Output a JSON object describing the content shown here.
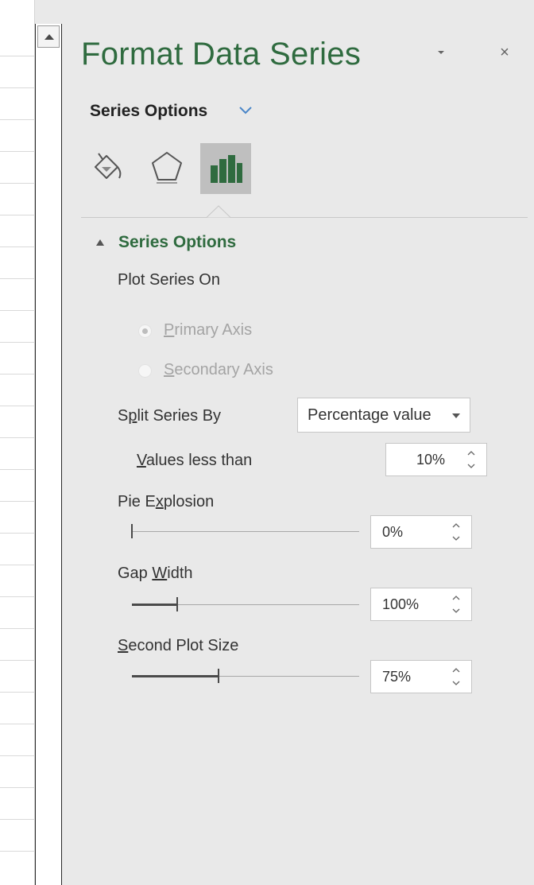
{
  "pane": {
    "title": "Format Data Series",
    "pin_icon": "chevron-down-icon",
    "close_label": "×",
    "menu_label": "Series Options",
    "tabs": [
      {
        "icon": "fill-line-icon",
        "selected": false
      },
      {
        "icon": "effects-pentagon-icon",
        "selected": false
      },
      {
        "icon": "series-options-chart-icon",
        "selected": true
      }
    ],
    "accent_color": "#2f6b3f"
  },
  "series_options": {
    "section_title": "Series Options",
    "plot_series_on": {
      "label": "Plot Series On",
      "primary": {
        "prefix": "",
        "underlined": "P",
        "rest": "rimary Axis",
        "checked": true,
        "enabled": false
      },
      "secondary": {
        "prefix": "",
        "underlined": "S",
        "rest": "econdary Axis",
        "checked": false,
        "enabled": false
      }
    },
    "split_series_by": {
      "prefix": "S",
      "underlined": "p",
      "rest": "lit Series By",
      "value": "Percentage value"
    },
    "values_less_than": {
      "prefix": "",
      "underlined": "V",
      "rest": "alues less than",
      "value": "10%"
    },
    "pie_explosion": {
      "prefix": "Pie E",
      "underlined": "x",
      "rest": "plosion",
      "value": "0%",
      "fraction": 0.0
    },
    "gap_width": {
      "prefix": "Gap ",
      "underlined": "W",
      "rest": "idth",
      "value": "100%",
      "fraction": 0.2
    },
    "second_plot_size": {
      "prefix": "",
      "underlined": "S",
      "rest": "econd Plot Size",
      "value": "75%",
      "fraction": 0.38
    }
  }
}
